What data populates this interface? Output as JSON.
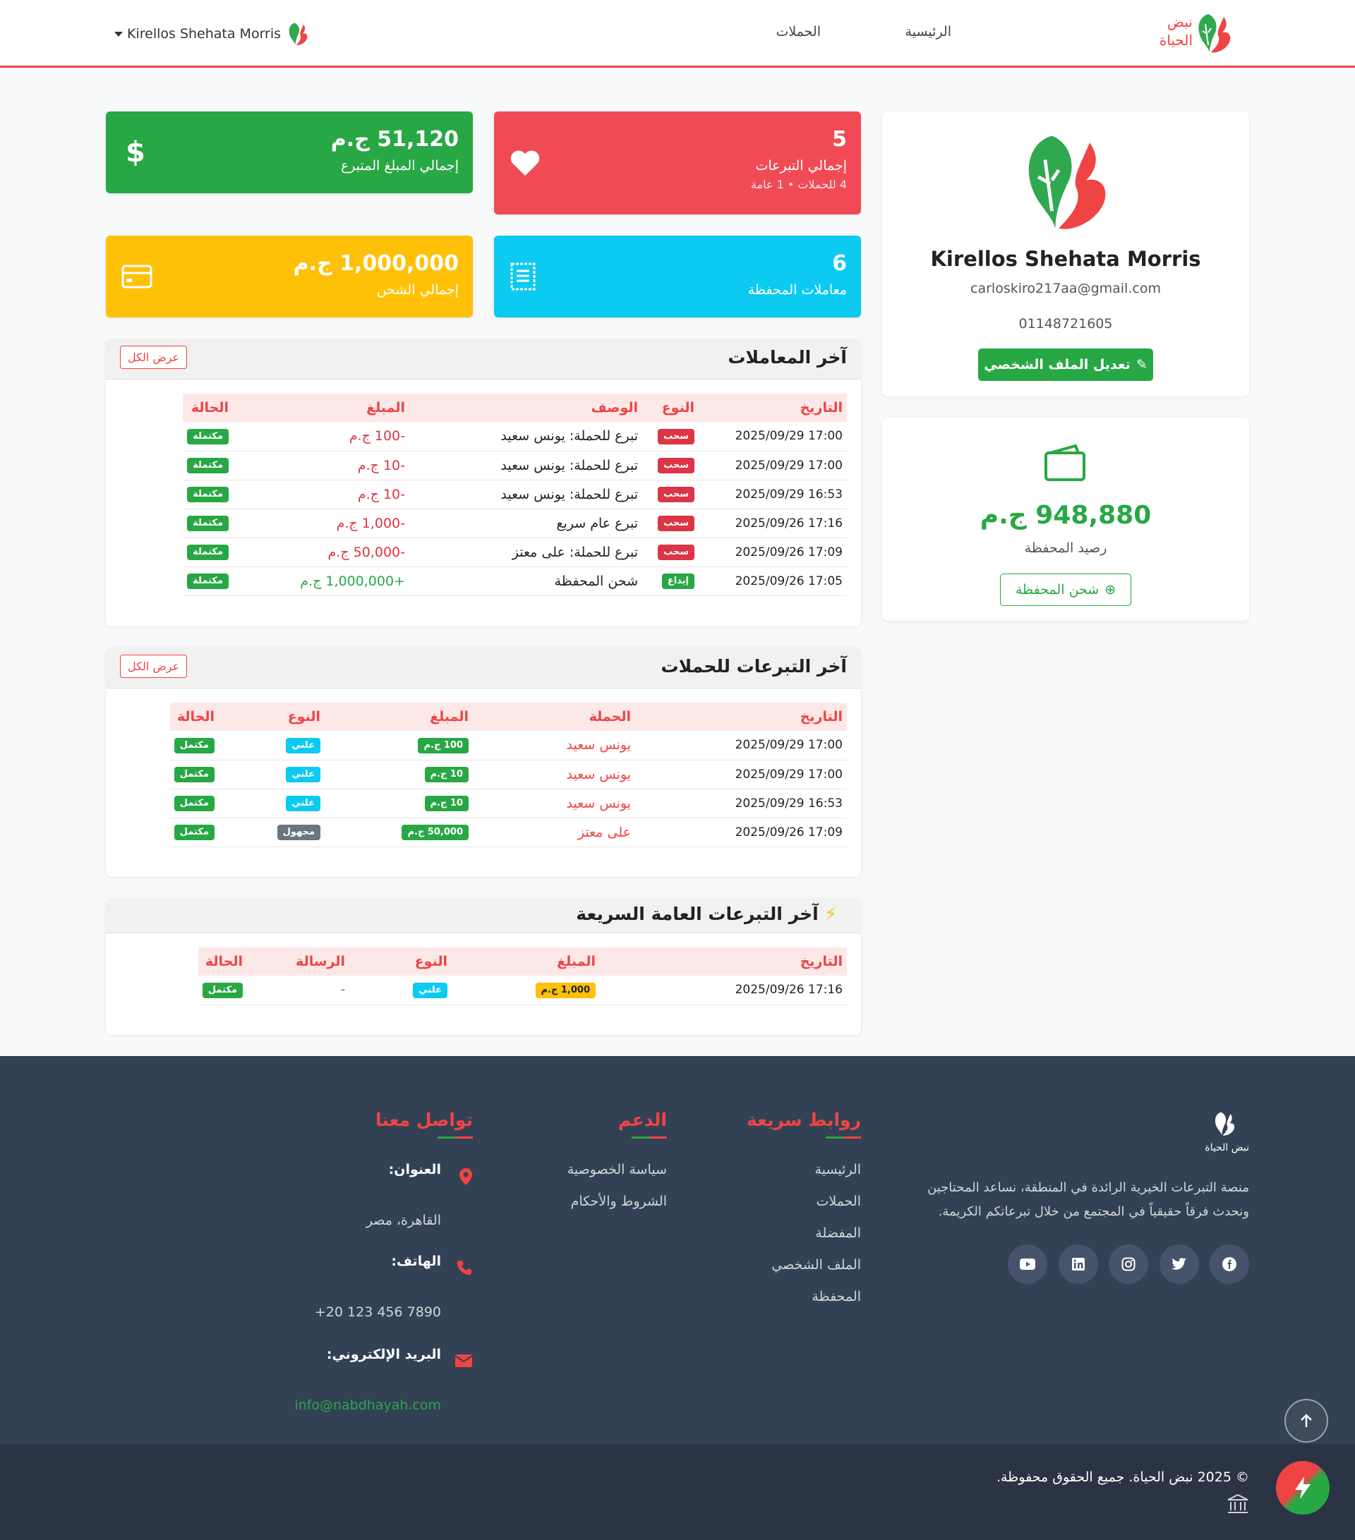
{
  "nav": {
    "brand_line1": "نبض",
    "brand_line2": "الحياة",
    "links": [
      "الرئيسية",
      "الحملات"
    ],
    "user_name": "Kirellos Shehata Morris"
  },
  "profile": {
    "name": "Kirellos Shehata Morris",
    "email": "carloskiro217aa@gmail.com",
    "phone": "01148721605",
    "edit_button": "تعديل الملف الشخصي"
  },
  "wallet": {
    "balance": "948,880 ج.م",
    "label": "رصيد المحفظة",
    "charge_button": "شحن المحفظة"
  },
  "stats": {
    "donations": {
      "value": "5",
      "label": "إجمالي التبرعات",
      "sub": "4 للحملات • 1 عامة",
      "color": "#f04b55"
    },
    "donated_total": {
      "value": "51,120 ج.م",
      "label": "إجمالي المبلغ المتبرع",
      "color": "#28a745"
    },
    "wallet_tx": {
      "value": "6",
      "label": "معاملات المحفظة",
      "color": "#0dcaf0"
    },
    "charge_total": {
      "value": "1,000,000 ج.م",
      "label": "إجمالي الشحن",
      "color": "#ffc107"
    }
  },
  "transactions": {
    "title": "آخر المعاملات",
    "view_all": "عرض الكل",
    "headers": [
      "التاريخ",
      "النوع",
      "الوصف",
      "المبلغ",
      "الحالة"
    ],
    "rows": [
      {
        "date": "2025/09/29 17:00",
        "type": "سحب",
        "desc": "تبرع للحملة: يونس سعيد",
        "amount": "-100 ج.م",
        "status": "مكتملة"
      },
      {
        "date": "2025/09/29 17:00",
        "type": "سحب",
        "desc": "تبرع للحملة: يونس سعيد",
        "amount": "-10 ج.م",
        "status": "مكتملة"
      },
      {
        "date": "2025/09/29 16:53",
        "type": "سحب",
        "desc": "تبرع للحملة: يونس سعيد",
        "amount": "-10 ج.م",
        "status": "مكتملة"
      },
      {
        "date": "2025/09/26 17:16",
        "type": "سحب",
        "desc": "تبرع عام سريع",
        "amount": "-1,000 ج.م",
        "status": "مكتملة"
      },
      {
        "date": "2025/09/26 17:09",
        "type": "سحب",
        "desc": "تبرع للحملة: على معتز",
        "amount": "-50,000 ج.م",
        "status": "مكتملة"
      },
      {
        "date": "2025/09/26 17:05",
        "type": "إيداع",
        "desc": "شحن المحفظة",
        "amount": "+1,000,000 ج.م",
        "status": "مكتملة"
      }
    ]
  },
  "campaign_donations": {
    "title": "آخر التبرعات للحملات",
    "view_all": "عرض الكل",
    "headers": [
      "التاريخ",
      "الحملة",
      "المبلغ",
      "النوع",
      "الحالة"
    ],
    "rows": [
      {
        "date": "2025/09/29 17:00",
        "campaign": "يونس سعيد",
        "amount": "100 ج.م",
        "type": "علني",
        "status": "مكتمل"
      },
      {
        "date": "2025/09/29 17:00",
        "campaign": "يونس سعيد",
        "amount": "10 ج.م",
        "type": "علني",
        "status": "مكتمل"
      },
      {
        "date": "2025/09/29 16:53",
        "campaign": "يونس سعيد",
        "amount": "10 ج.م",
        "type": "علني",
        "status": "مكتمل"
      },
      {
        "date": "2025/09/26 17:09",
        "campaign": "على معتز",
        "amount": "50,000 ج.م",
        "type": "مجهول",
        "status": "مكتمل"
      }
    ]
  },
  "quick_donations": {
    "title": "آخر التبرعات العامة السريعة",
    "headers": [
      "التاريخ",
      "المبلغ",
      "النوع",
      "الرسالة",
      "الحالة"
    ],
    "rows": [
      {
        "date": "2025/09/26 17:16",
        "amount": "1,000 ج.م",
        "type": "علني",
        "message": "-",
        "status": "مكتمل"
      }
    ]
  },
  "footer": {
    "logo_text": "نبض الحياة",
    "about": "منصة التبرعات الخيرية الرائدة في المنطقة، نساعد المحتاجين ونحدث فرقاً حقيقياً في المجتمع من خلال تبرعاتكم الكريمة.",
    "quick_links_title": "روابط سريعة",
    "quick_links": [
      "الرئيسية",
      "الحملات",
      "المفضلة",
      "الملف الشخصي",
      "المحفظة"
    ],
    "support_title": "الدعم",
    "support_links": [
      "سياسة الخصوصية",
      "الشروط والأحكام"
    ],
    "contact_title": "تواصل معنا",
    "address_label": "العنوان:",
    "address": "القاهرة، مصر",
    "phone_label": "الهاتف:",
    "phone": "+20 123 456 7890",
    "email_label": "البريد الإلكتروني:",
    "email": "info@nabdhayah.com",
    "copyright": "© 2025 نبض الحياة. جميع الحقوق محفوظة."
  }
}
